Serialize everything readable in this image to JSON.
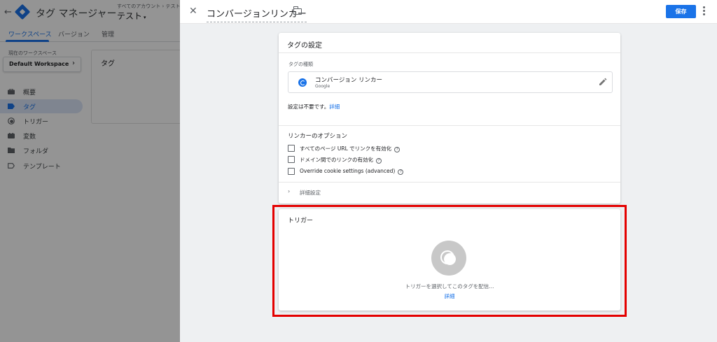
{
  "app": {
    "back_icon": "arrow-left-icon",
    "title": "タグ マネージャー",
    "account_breadcrumb": "すべてのアカウント › テスト",
    "container_name": "テスト",
    "container_dropdown": "▾"
  },
  "app_tabs": [
    {
      "label": "ワークスペース",
      "active": true
    },
    {
      "label": "バージョン",
      "active": false
    },
    {
      "label": "管理",
      "active": false
    }
  ],
  "workspace": {
    "label": "現在のワークスペース",
    "name": "Default Workspace",
    "chevron": "›"
  },
  "sidebar": {
    "items": [
      {
        "label": "概要",
        "icon": "briefcase-icon",
        "active": false
      },
      {
        "label": "タグ",
        "icon": "tag-icon",
        "active": true
      },
      {
        "label": "トリガー",
        "icon": "trigger-icon",
        "active": false
      },
      {
        "label": "変数",
        "icon": "variables-icon",
        "active": false
      },
      {
        "label": "フォルダ",
        "icon": "folder-icon",
        "active": false
      },
      {
        "label": "テンプレート",
        "icon": "template-icon",
        "active": false
      }
    ]
  },
  "tag_panel": {
    "title": "タグ"
  },
  "editor": {
    "close_icon": "close-icon",
    "close_glyph": "✕",
    "tag_name": "コンバージョンリンカー",
    "save_label": "保存",
    "tag_config": {
      "title": "タグの設定",
      "type_label": "タグの種類",
      "type_name": "コンバージョン リンカー",
      "type_vendor": "Google",
      "no_config_text": "設定は不要です。",
      "no_config_link": "詳細",
      "options_title": "リンカーのオプション",
      "options": [
        {
          "label": "すべてのページ URL でリンクを有効化",
          "checked": false
        },
        {
          "label": "ドメイン間でのリンクの有効化",
          "checked": false
        },
        {
          "label": "Override cookie settings (advanced)",
          "checked": false
        }
      ],
      "help_glyph": "?",
      "advanced_chevron": "›",
      "advanced_label": "詳細設定"
    },
    "triggering": {
      "title": "トリガー",
      "hint": "トリガーを選択してこのタグを配信...",
      "more_link": "詳細"
    }
  },
  "colors": {
    "accent": "#1a73e8",
    "highlight_border": "#e40000",
    "overlay": "rgba(0,0,0,0.42)"
  }
}
